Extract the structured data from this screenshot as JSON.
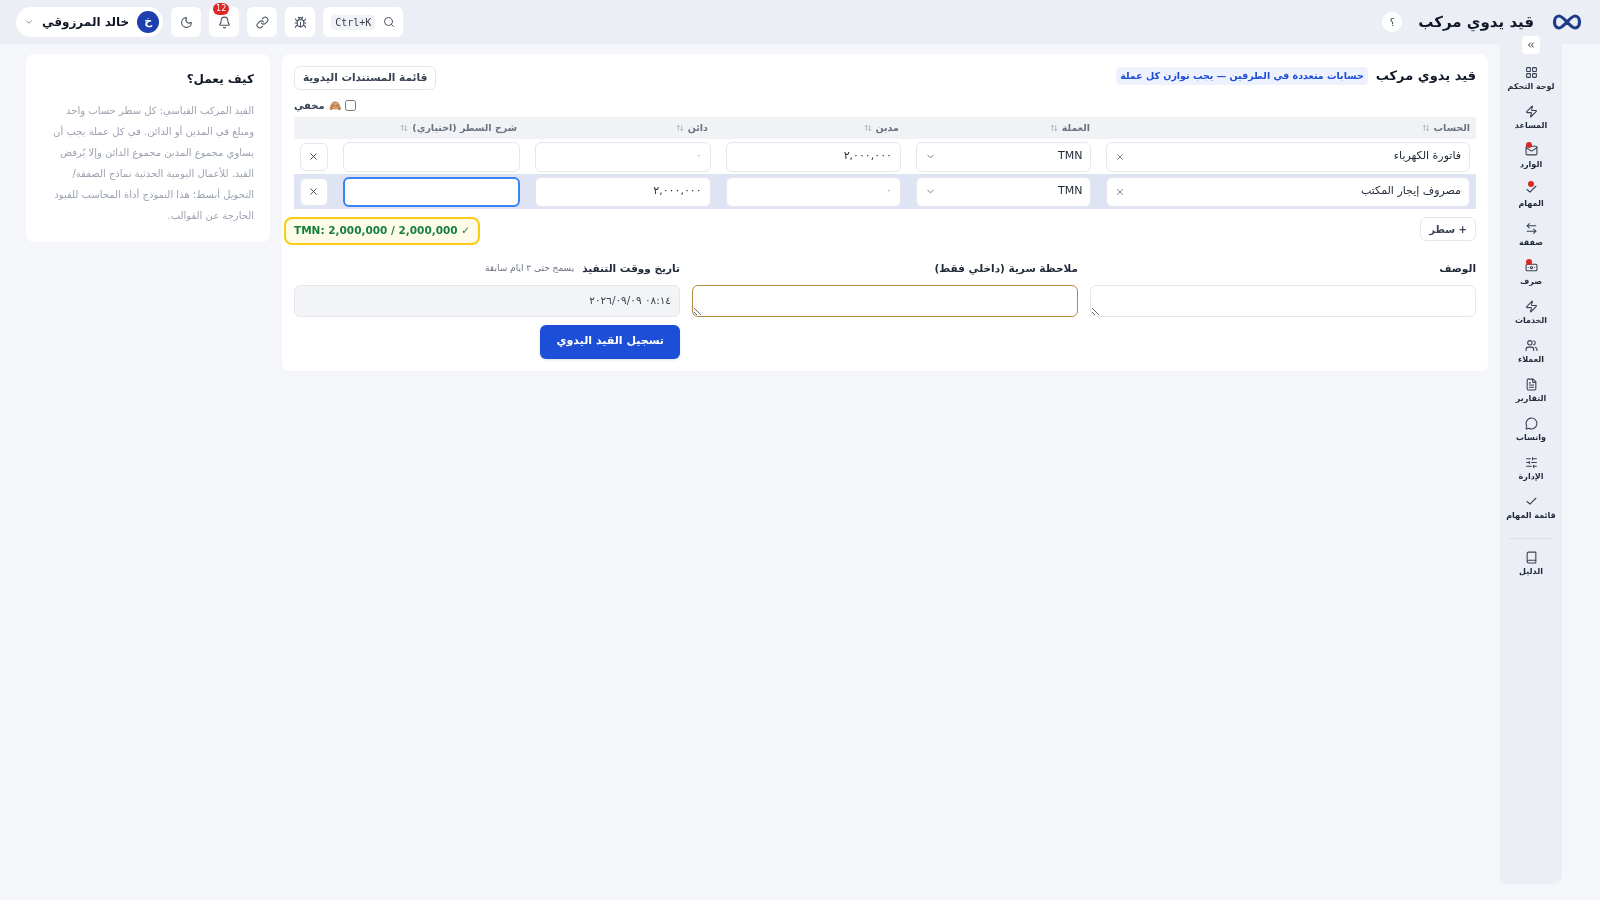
{
  "header": {
    "title": "قيد يدوي مركب",
    "help": "؟",
    "search_shortcut": "Ctrl+K",
    "notifications": "12",
    "user": {
      "initial": "خ",
      "name": "خالد المرزوقي"
    }
  },
  "sidebar": {
    "items": [
      {
        "label": "لوحة التحكم",
        "badge": false
      },
      {
        "label": "المساعد",
        "badge": false
      },
      {
        "label": "الوارد",
        "badge": true
      },
      {
        "label": "المهام",
        "badge": true
      },
      {
        "label": "صفقة",
        "badge": false
      },
      {
        "label": "صرف",
        "badge": true
      },
      {
        "label": "الخدمات",
        "badge": false
      },
      {
        "label": "العملاء",
        "badge": false
      },
      {
        "label": "التقارير",
        "badge": false
      },
      {
        "label": "واتساب",
        "badge": false
      },
      {
        "label": "الإدارة",
        "badge": false
      },
      {
        "label": "قائمة المهام",
        "badge": false
      }
    ],
    "footer_item": {
      "label": "الدليل"
    }
  },
  "card": {
    "title": "قيد يدوي مركب",
    "tag": "حسابات متعددة في الطرفين — يجب توازن كل عملة",
    "list_button": "قائمة المستندات اليدوية",
    "hidden_toggle": {
      "label": "مخفي",
      "emoji": "🙈",
      "checked": false
    },
    "table": {
      "columns": [
        "الحساب",
        "العملة",
        "مدين",
        "دائن",
        "شرح السطر (اختياري)"
      ],
      "rows": [
        {
          "account": "فاتورة الكهرباء",
          "currency": "TMN",
          "debit": {
            "value": "٢,٠٠٠,٠٠٠"
          },
          "credit": {
            "placeholder": "٠"
          },
          "note": {
            "focused": false
          },
          "selected": false
        },
        {
          "account": "مصروف إيجار المكتب",
          "currency": "TMN",
          "debit": {
            "placeholder": "٠"
          },
          "credit": {
            "value": "٢,٠٠٠,٠٠٠"
          },
          "note": {
            "focused": true
          },
          "selected": true
        }
      ]
    },
    "add_row": "+ سطر",
    "balance": {
      "text": "TMN: 2,000,000 / 2,000,000 ✓",
      "balanced": true
    },
    "fields": {
      "description": {
        "label": "الوصف"
      },
      "secret_note": {
        "label": "ملاحظة سرية (داخلي فقط)",
        "focused": true
      },
      "datetime": {
        "label": "تاريخ ووقت التنفيذ",
        "hint": "يسمح حتى ٣ ايام سابقة",
        "value": "٠٨:١٤ ٢٠٢٦/٠٩/٠٩",
        "disabled": true
      }
    },
    "submit": "تسجيل القيد اليدوي"
  },
  "help_card": {
    "title": "كيف يعمل؟",
    "text": "القيد المركب القياسي: كل سطر حساب واحد ومبلغ في المدين أو الدائن. في كل عملة يجب أن يساوي مجموع المدين مجموع الدائن وإلا يُرفض القيد. للأعمال اليومية الحدثية نماذج الصفقة/التحويل أبسط؛ هذا النموذج أداة المحاسب للقيود الخارجة عن القوالب."
  }
}
